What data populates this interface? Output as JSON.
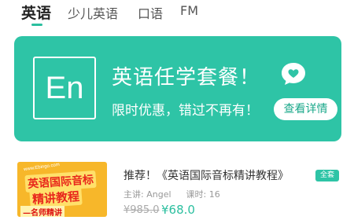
{
  "tabs": [
    {
      "label": "英语",
      "active": true
    },
    {
      "label": "少儿英语",
      "active": false
    },
    {
      "label": "口语",
      "active": false
    },
    {
      "label": "FM",
      "active": false
    }
  ],
  "banner": {
    "logo_text": "En",
    "title": "英语任学套餐！",
    "subtitle": "限时优惠，错过不再有！",
    "cta": "查看详情",
    "bg_color": "#2ec4a6",
    "icon": "chat-heart-icon"
  },
  "course": {
    "thumb": {
      "domain": "www.Ebingo.com",
      "line1": "英语国际音标",
      "line2": "精讲教程",
      "line3": "—名师精讲"
    },
    "title": "推荐！《英语国际音标精讲教程》",
    "badge": "全套",
    "teacher_label": "主讲:",
    "teacher": "Angel",
    "lessons_label": "课时:",
    "lessons": "16",
    "price_old": "¥985.0",
    "price_new": "¥68.0",
    "accent_color": "#2bbf9f"
  }
}
